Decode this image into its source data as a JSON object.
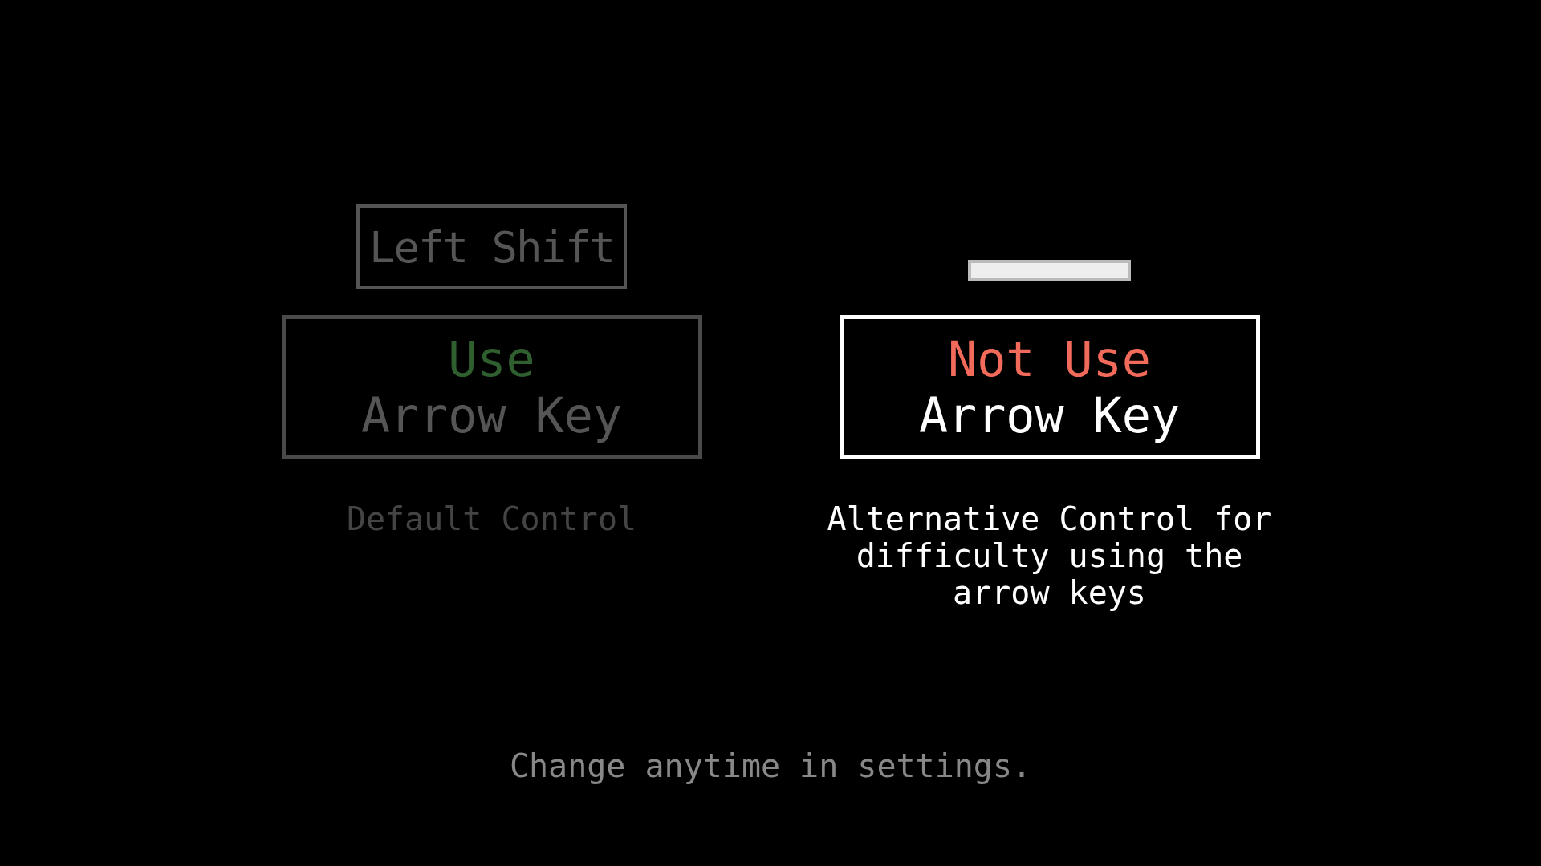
{
  "options": [
    {
      "key": {
        "kind": "text",
        "label": "Left Shift"
      },
      "selected": false,
      "color": "#2f5f2f",
      "line_1": "Use",
      "line_2": "Arrow Key",
      "description": "Default Control"
    },
    {
      "key": {
        "kind": "bar"
      },
      "selected": true,
      "color": "#f26a5a",
      "line_1": "Not Use",
      "line_2": "Arrow Key",
      "description": "Alternative Control for difficulty using the arrow keys"
    }
  ],
  "footer": "Change anytime in settings."
}
